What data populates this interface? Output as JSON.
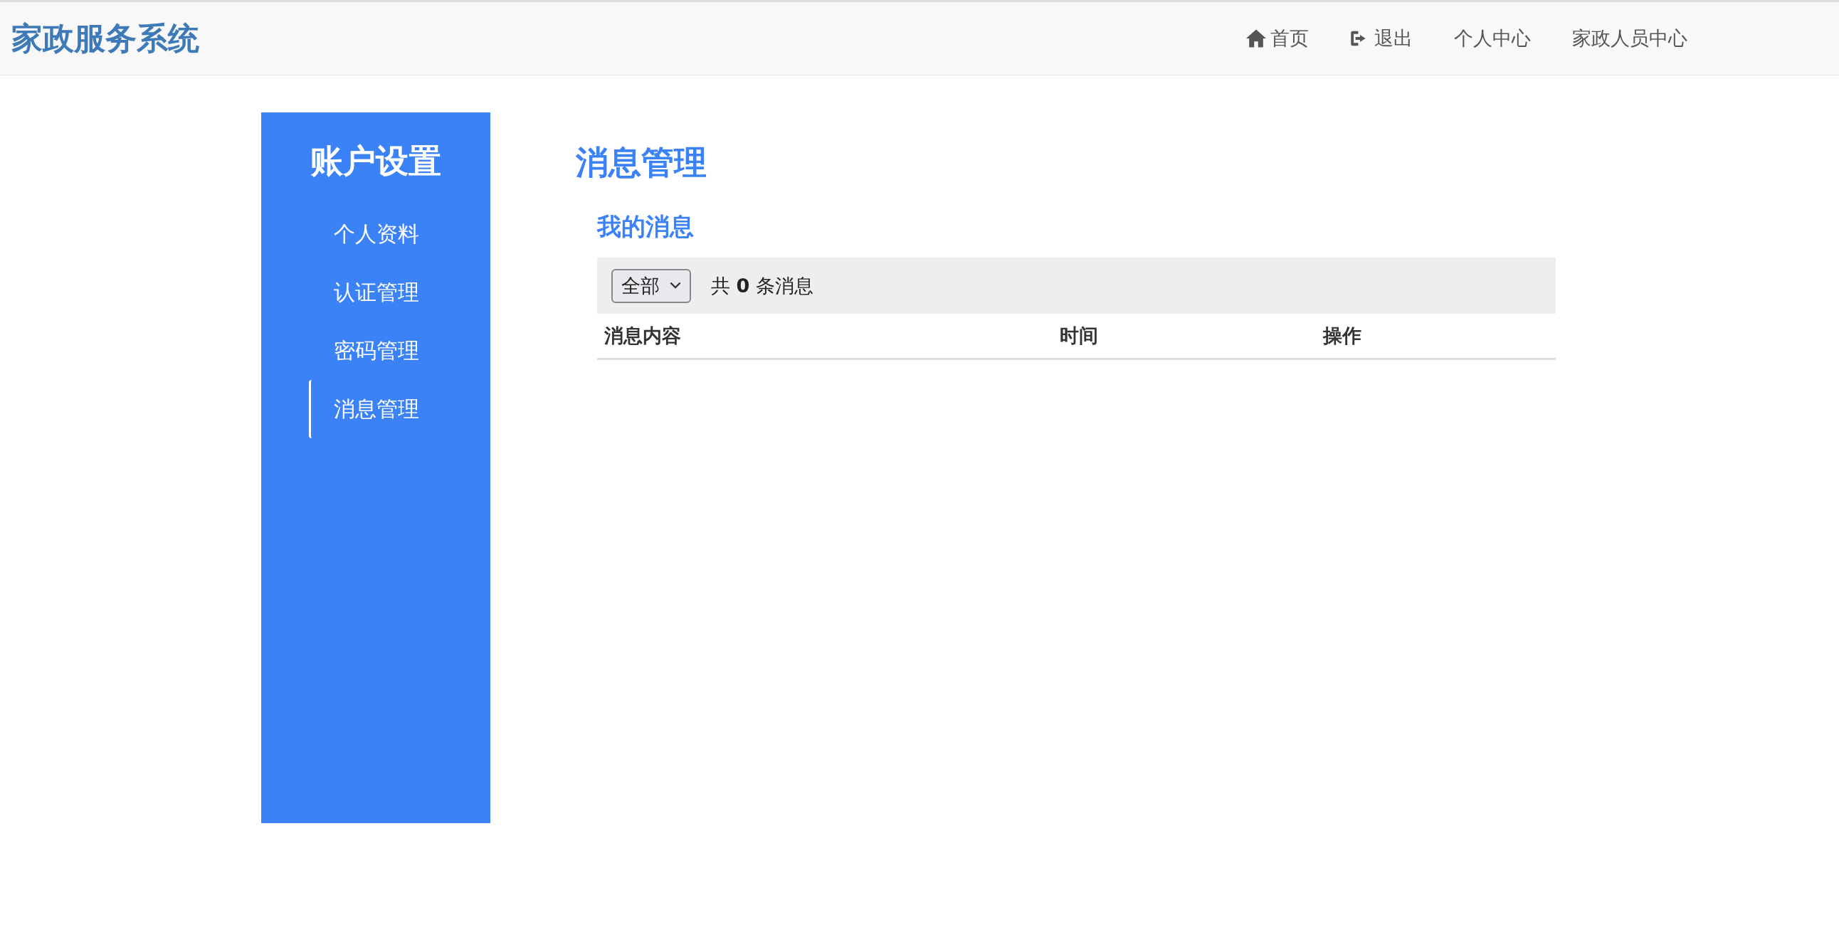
{
  "header": {
    "title": "家政服务系统",
    "nav": [
      {
        "label": "首页",
        "kind": "home"
      },
      {
        "label": "退出",
        "kind": "logout"
      },
      {
        "label": "个人中心",
        "kind": "text"
      },
      {
        "label": "家政人员中心",
        "kind": "text"
      }
    ]
  },
  "sidebar": {
    "title": "账户设置",
    "items": [
      {
        "label": "个人资料",
        "selected": false
      },
      {
        "label": "认证管理",
        "selected": false
      },
      {
        "label": "密码管理",
        "selected": false
      },
      {
        "label": "消息管理",
        "selected": true
      }
    ]
  },
  "main": {
    "title": "消息管理",
    "section_title": "我的消息",
    "filter": {
      "value": "全部"
    },
    "count_text": "共 **0** 条消息",
    "table": {
      "columns": [
        "消息内容",
        "时间",
        "操作"
      ]
    }
  }
}
